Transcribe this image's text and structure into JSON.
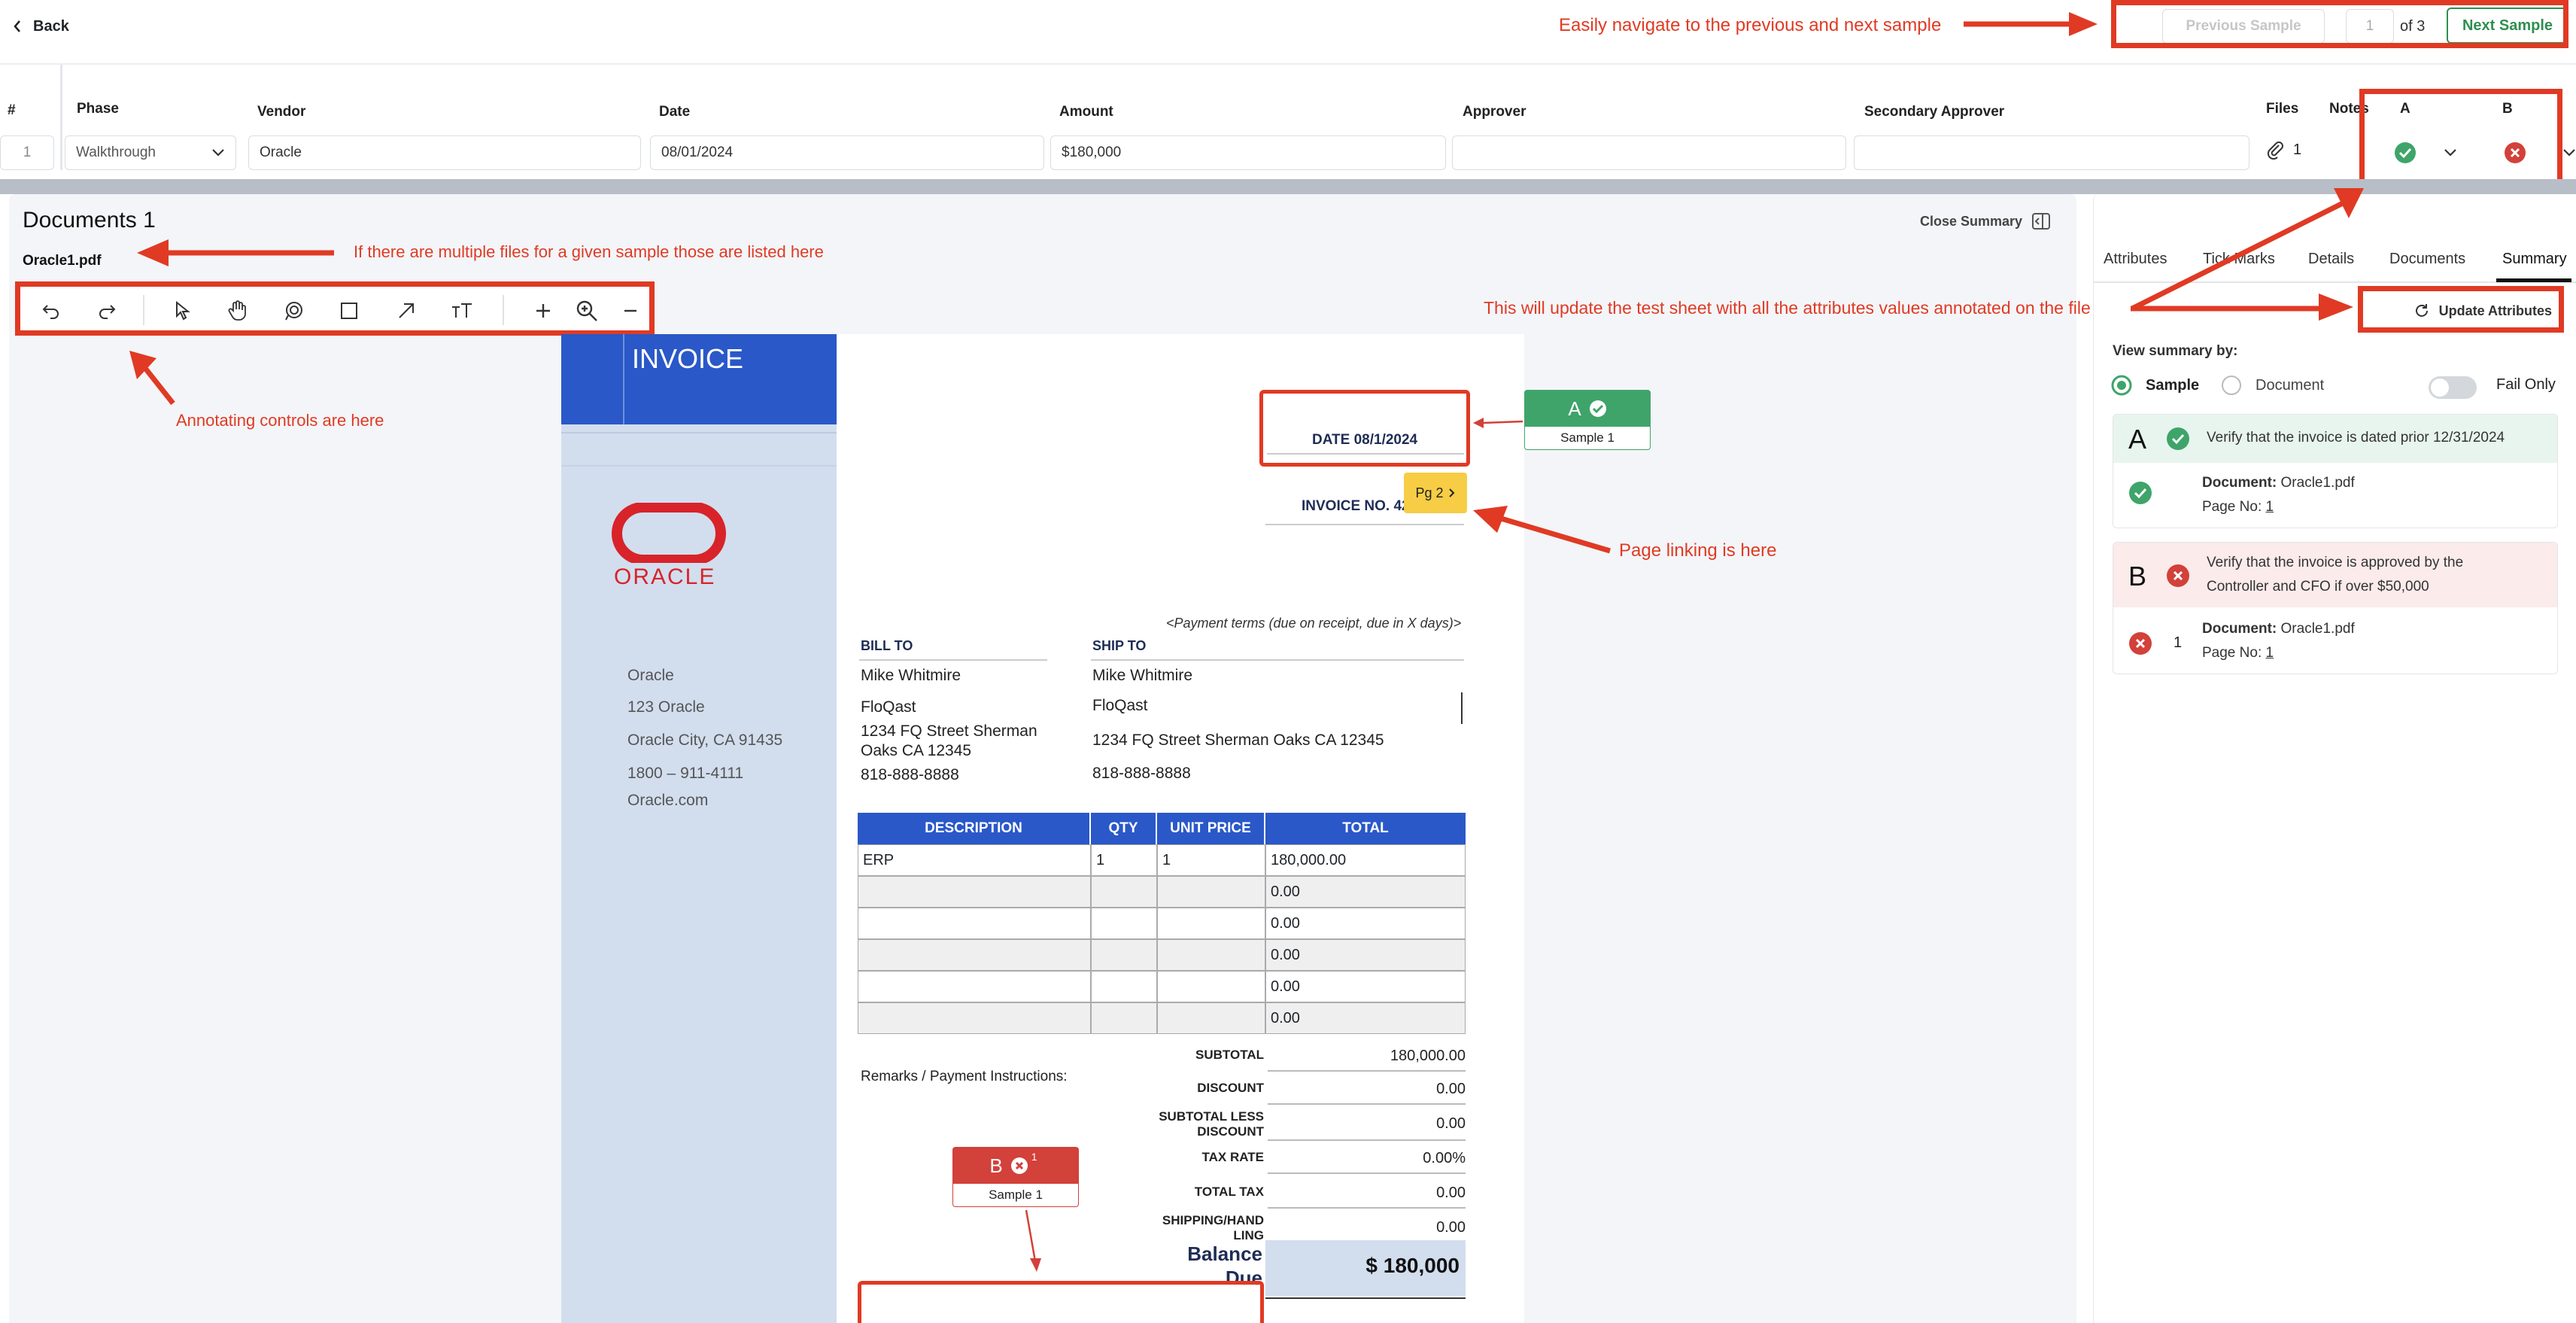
{
  "nav": {
    "back_label": "Back",
    "previous_label": "Previous Sample",
    "page_value": "1",
    "page_total": "of 3",
    "next_label": "Next Sample"
  },
  "callouts": {
    "navigate": "Easily navigate to the previous and next sample",
    "multiple_files": "If there are multiple files for a  given sample those are listed here",
    "annotating": "Annotating controls are here",
    "update": "This will update the test sheet with all the attributes values annotated on the file",
    "page_linking": "Page linking is here"
  },
  "grid": {
    "headers": {
      "num": "#",
      "phase": "Phase",
      "vendor": "Vendor",
      "date": "Date",
      "amount": "Amount",
      "approver": "Approver",
      "secondary": "Secondary Approver",
      "files": "Files",
      "notes": "Notes",
      "a": "A",
      "b": "B"
    },
    "row": {
      "num": "1",
      "phase": "Walkthrough",
      "vendor": "Oracle",
      "date": "08/01/2024",
      "amount": "$180,000",
      "approver": "",
      "secondary": "",
      "files": "1"
    }
  },
  "documents": {
    "title": "Documents 1",
    "file": "Oracle1.pdf",
    "close_summary": "Close Summary"
  },
  "invoice": {
    "heading": "INVOICE",
    "logo_text": "ORACLE",
    "company": [
      "Oracle",
      "123 Oracle",
      "Oracle City, CA 91435",
      "1800 – 911-4111",
      "Oracle.com"
    ],
    "date": "DATE 08/1/2024",
    "invoice_no": "INVOICE NO. 42",
    "payment_terms": "<Payment terms (due on receipt, due in X days)>",
    "bill_to_label": "BILL TO",
    "ship_to_label": "SHIP TO",
    "bill_to": [
      "Mike Whitmire",
      "FloQast",
      "1234 FQ Street Sherman",
      "Oaks CA 12345",
      "818-888-8888"
    ],
    "ship_to": [
      "Mike Whitmire",
      "FloQast",
      "1234 FQ Street Sherman Oaks CA 12345",
      "818-888-8888"
    ],
    "columns": [
      "DESCRIPTION",
      "QTY",
      "UNIT PRICE",
      "TOTAL"
    ],
    "rows": [
      [
        "ERP",
        "1",
        "1",
        "180,000.00"
      ],
      [
        "",
        "",
        "",
        "0.00"
      ],
      [
        "",
        "",
        "",
        "0.00"
      ],
      [
        "",
        "",
        "",
        "0.00"
      ],
      [
        "",
        "",
        "",
        "0.00"
      ],
      [
        "",
        "",
        "",
        "0.00"
      ]
    ],
    "remarks": "Remarks / Payment Instructions:",
    "totals": [
      {
        "label": "SUBTOTAL",
        "value": "180,000.00"
      },
      {
        "label": "DISCOUNT",
        "value": "0.00"
      },
      {
        "label": "SUBTOTAL LESS DISCOUNT",
        "value": "0.00"
      },
      {
        "label": "TAX RATE",
        "value": "0.00%"
      },
      {
        "label": "TOTAL TAX",
        "value": "0.00"
      },
      {
        "label": "SHIPPING/HAND LING",
        "value": "0.00"
      }
    ],
    "balance_label": "Balance Due",
    "balance_value": "$ 180,000"
  },
  "annotations": {
    "a_letter": "A",
    "a_sample": "Sample 1",
    "b_letter": "B",
    "b_sup": "1",
    "b_sample": "Sample 1",
    "page_link": "Pg 2"
  },
  "panel": {
    "tabs": [
      "Attributes",
      "Tick Marks",
      "Details",
      "Documents",
      "Summary"
    ],
    "update_label": "Update Attributes",
    "view_by": "View summary by:",
    "radio_sample": "Sample",
    "radio_document": "Document",
    "fail_only": "Fail Only",
    "attr_a": {
      "letter": "A",
      "text": "Verify that the invoice is dated prior 12/31/2024",
      "doc_label": "Document:",
      "doc": "Oracle1.pdf",
      "page_label": "Page No:",
      "page": "1"
    },
    "attr_b": {
      "letter": "B",
      "text1": "Verify that the invoice is approved by the",
      "text2": "Controller and CFO if over $50,000",
      "count": "1",
      "doc_label": "Document:",
      "doc": "Oracle1.pdf",
      "page_label": "Page No:",
      "page": "1"
    }
  },
  "colors": {
    "accent_red": "#e03a24",
    "pass_green": "#3fa46a",
    "fail_red": "#d2413a",
    "invoice_blue": "#2a58c8",
    "next_green": "#2f8f4e"
  }
}
